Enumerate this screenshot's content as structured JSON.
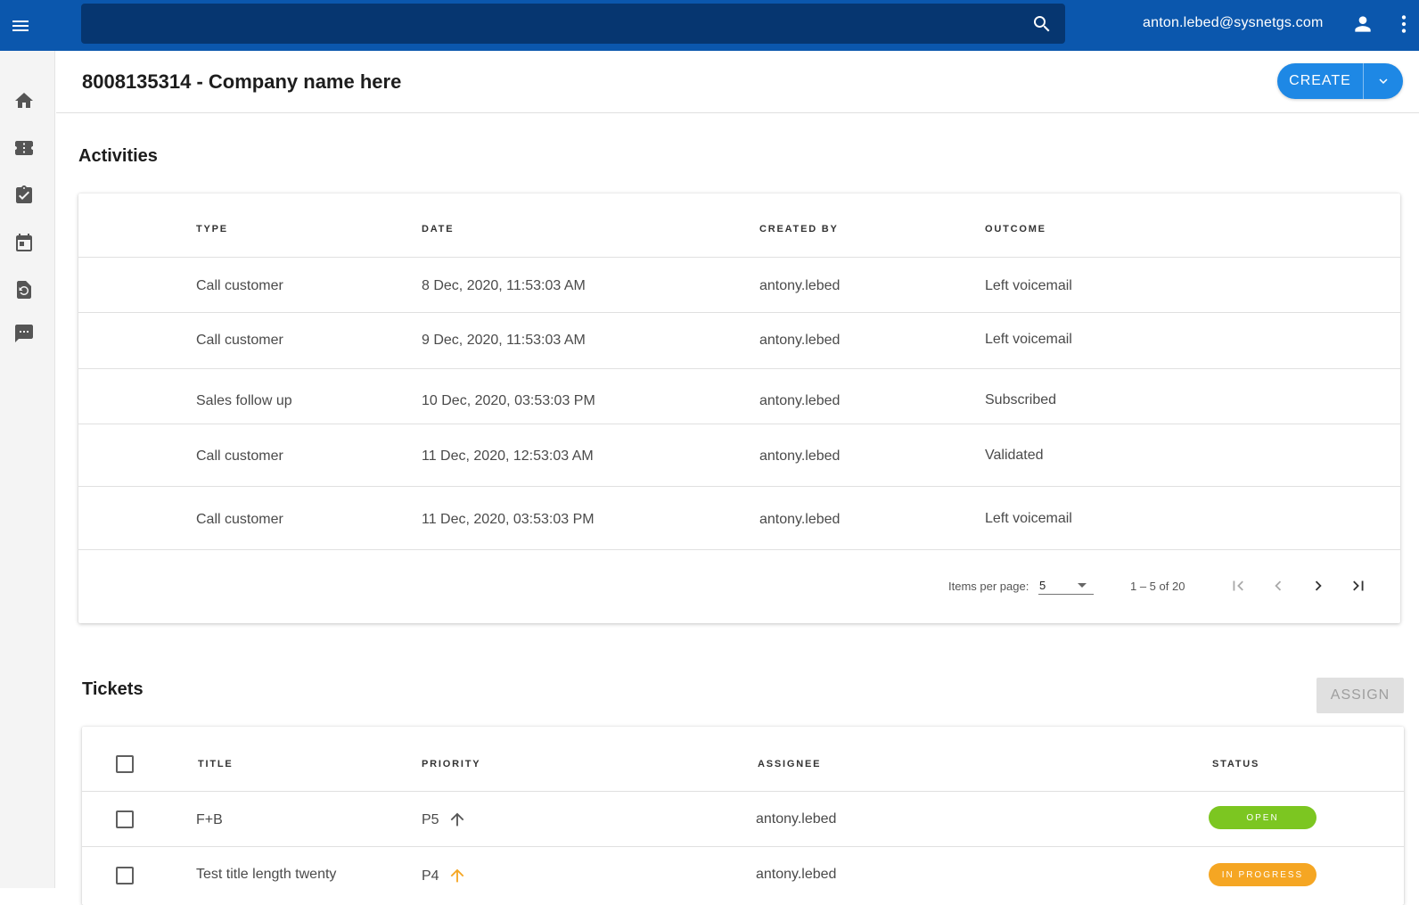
{
  "topbar": {
    "user_email": "anton.lebed@sysnetgs.com",
    "search_placeholder": ""
  },
  "sidebar": {
    "items": [
      {
        "icon": "home-icon"
      },
      {
        "icon": "ticket-icon"
      },
      {
        "icon": "assignment-icon"
      },
      {
        "icon": "calendar-icon"
      },
      {
        "icon": "history-icon"
      },
      {
        "icon": "chat-icon"
      }
    ]
  },
  "header": {
    "title": "8008135314 - Company name here",
    "create_label": "CREATE"
  },
  "activities": {
    "title": "Activities",
    "columns": [
      "TYPE",
      "DATE",
      "CREATED BY",
      "OUTCOME"
    ],
    "rows": [
      {
        "type": "Call customer",
        "date": "8 Dec, 2020, 11:53:03 AM",
        "created_by": "antony.lebed",
        "outcome": "Left voicemail"
      },
      {
        "type": "Call customer",
        "date": "9 Dec, 2020, 11:53:03 AM",
        "created_by": "antony.lebed",
        "outcome": "Left voicemail"
      },
      {
        "type": "Sales follow up",
        "date": "10 Dec, 2020, 03:53:03 PM",
        "created_by": "antony.lebed",
        "outcome": "Subscribed"
      },
      {
        "type": "Call customer",
        "date": "11 Dec, 2020, 12:53:03 AM",
        "created_by": "antony.lebed",
        "outcome": "Validated"
      },
      {
        "type": "Call customer",
        "date": "11 Dec, 2020, 03:53:03 PM",
        "created_by": "antony.lebed",
        "outcome": "Left voicemail"
      }
    ],
    "paginator": {
      "items_per_page_label": "Items per page:",
      "items_per_page_value": "5",
      "range_label": "1 – 5 of 20"
    }
  },
  "tickets": {
    "title": "Tickets",
    "assign_label": "ASSIGN",
    "columns": [
      "TITLE",
      "PRIORITY",
      "ASSIGNEE",
      "STATUS"
    ],
    "rows": [
      {
        "title": "F+B",
        "priority": "P5",
        "priority_color": "#555555",
        "assignee": "antony.lebed",
        "status": "OPEN",
        "status_color": "#7cc621"
      },
      {
        "title": "Test title length twenty",
        "priority": "P4",
        "priority_color": "#f5a623",
        "assignee": "antony.lebed",
        "status": "IN PROGRESS",
        "status_color": "#f5a623"
      }
    ]
  },
  "colors": {
    "topbar": "#0b57ad",
    "searchbar": "#063670",
    "accent": "#1e88e5"
  }
}
